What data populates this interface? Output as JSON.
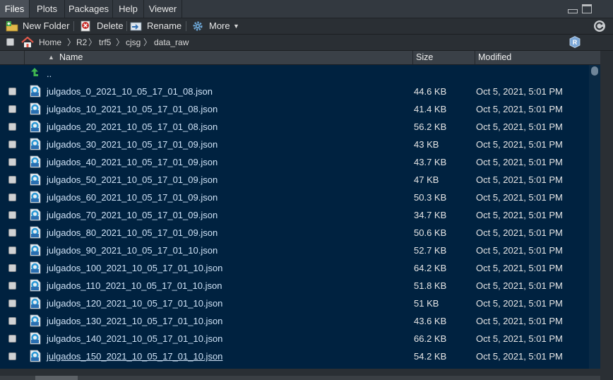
{
  "tabs": [
    {
      "label": "Files",
      "active": true
    },
    {
      "label": "Plots",
      "active": false
    },
    {
      "label": "Packages",
      "active": false
    },
    {
      "label": "Help",
      "active": false
    },
    {
      "label": "Viewer",
      "active": false
    }
  ],
  "toolbar": {
    "new_folder": "New Folder",
    "delete": "Delete",
    "rename": "Rename",
    "more": "More"
  },
  "breadcrumb": [
    "Home",
    "R2",
    "trf5",
    "cjsg",
    "data_raw"
  ],
  "columns": {
    "name": "Name",
    "size": "Size",
    "modified": "Modified"
  },
  "parent_dir": "..",
  "files": [
    {
      "name": "julgados_0_2021_10_05_17_01_08.json",
      "size": "44.6 KB",
      "modified": "Oct 5, 2021, 5:01 PM"
    },
    {
      "name": "julgados_10_2021_10_05_17_01_08.json",
      "size": "41.4 KB",
      "modified": "Oct 5, 2021, 5:01 PM"
    },
    {
      "name": "julgados_20_2021_10_05_17_01_08.json",
      "size": "56.2 KB",
      "modified": "Oct 5, 2021, 5:01 PM"
    },
    {
      "name": "julgados_30_2021_10_05_17_01_09.json",
      "size": "43 KB",
      "modified": "Oct 5, 2021, 5:01 PM"
    },
    {
      "name": "julgados_40_2021_10_05_17_01_09.json",
      "size": "43.7 KB",
      "modified": "Oct 5, 2021, 5:01 PM"
    },
    {
      "name": "julgados_50_2021_10_05_17_01_09.json",
      "size": "47 KB",
      "modified": "Oct 5, 2021, 5:01 PM"
    },
    {
      "name": "julgados_60_2021_10_05_17_01_09.json",
      "size": "50.3 KB",
      "modified": "Oct 5, 2021, 5:01 PM"
    },
    {
      "name": "julgados_70_2021_10_05_17_01_09.json",
      "size": "34.7 KB",
      "modified": "Oct 5, 2021, 5:01 PM"
    },
    {
      "name": "julgados_80_2021_10_05_17_01_09.json",
      "size": "50.6 KB",
      "modified": "Oct 5, 2021, 5:01 PM"
    },
    {
      "name": "julgados_90_2021_10_05_17_01_10.json",
      "size": "52.7 KB",
      "modified": "Oct 5, 2021, 5:01 PM"
    },
    {
      "name": "julgados_100_2021_10_05_17_01_10.json",
      "size": "64.2 KB",
      "modified": "Oct 5, 2021, 5:01 PM"
    },
    {
      "name": "julgados_110_2021_10_05_17_01_10.json",
      "size": "51.8 KB",
      "modified": "Oct 5, 2021, 5:01 PM"
    },
    {
      "name": "julgados_120_2021_10_05_17_01_10.json",
      "size": "51 KB",
      "modified": "Oct 5, 2021, 5:01 PM"
    },
    {
      "name": "julgados_130_2021_10_05_17_01_10.json",
      "size": "43.6 KB",
      "modified": "Oct 5, 2021, 5:01 PM"
    },
    {
      "name": "julgados_140_2021_10_05_17_01_10.json",
      "size": "66.2 KB",
      "modified": "Oct 5, 2021, 5:01 PM"
    },
    {
      "name": "julgados_150_2021_10_05_17_01_10.json",
      "size": "54.2 KB",
      "modified": "Oct 5, 2021, 5:01 PM"
    }
  ],
  "icons": {
    "new_folder": "new-folder-icon",
    "delete": "delete-icon",
    "rename": "rename-icon",
    "more": "gear-icon",
    "refresh": "refresh-icon",
    "home": "home-icon",
    "project": "r-project-icon",
    "parent": "up-arrow-icon",
    "file": "json-file-icon"
  },
  "colors": {
    "background": "#002240",
    "file_link": "#cfe3f7",
    "header": "#3a4047",
    "toolbar": "#2a2f34"
  }
}
